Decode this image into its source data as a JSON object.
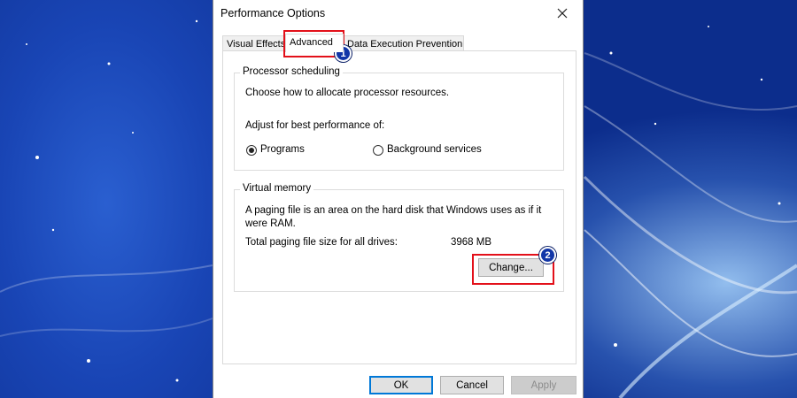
{
  "dialog": {
    "title": "Performance Options",
    "close_icon": "close-icon"
  },
  "tabs": [
    {
      "label": "Visual Effects",
      "active": false
    },
    {
      "label": "Advanced",
      "active": true
    },
    {
      "label": "Data Execution Prevention",
      "active": false
    }
  ],
  "processor_scheduling": {
    "title": "Processor scheduling",
    "description": "Choose how to allocate processor resources.",
    "adjust_label": "Adjust for best performance of:",
    "options": [
      {
        "label": "Programs",
        "checked": true
      },
      {
        "label": "Background services",
        "checked": false
      }
    ]
  },
  "virtual_memory": {
    "title": "Virtual memory",
    "description": "A paging file is an area on the hard disk that Windows uses as if it were RAM.",
    "total_label": "Total paging file size for all drives:",
    "total_value": "3968 MB",
    "change_label": "Change..."
  },
  "footer": {
    "ok_label": "OK",
    "cancel_label": "Cancel",
    "apply_label": "Apply"
  },
  "annotations": {
    "step1": "1",
    "step2": "2",
    "highlight_color": "#e3101a",
    "marker_color": "#1236a8"
  }
}
